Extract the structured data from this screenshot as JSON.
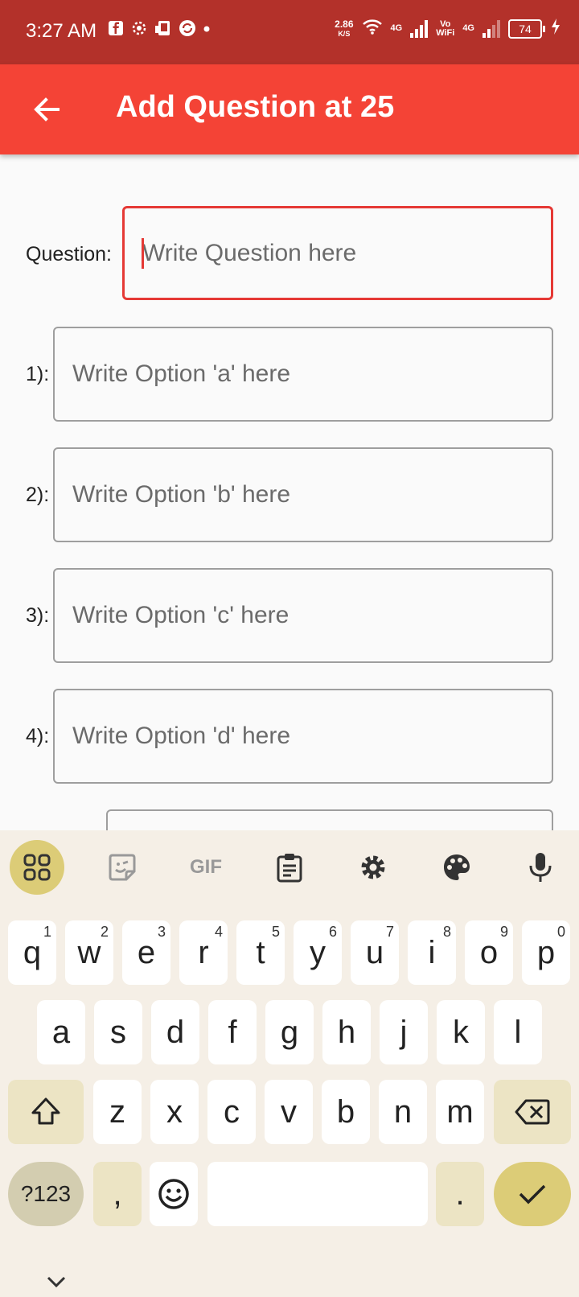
{
  "status_bar": {
    "time": "3:27 AM",
    "net_speed": "2.86",
    "net_unit": "K/S",
    "net_type_1": "4G",
    "vowifi_top": "Vo",
    "vowifi_bottom": "WiFi",
    "net_type_2": "4G",
    "battery": "74"
  },
  "app_bar": {
    "title": "Add Question at 25"
  },
  "form": {
    "question_label": "Question:",
    "question_placeholder": "Write Question here",
    "options": [
      {
        "label": "1):",
        "placeholder": "Write Option 'a' here"
      },
      {
        "label": "2):",
        "placeholder": "Write Option 'b' here"
      },
      {
        "label": "3):",
        "placeholder": "Write Option 'c' here"
      },
      {
        "label": "4):",
        "placeholder": "Write Option 'd' here"
      }
    ]
  },
  "keyboard": {
    "toolbar": {
      "gif_label": "GIF"
    },
    "row1": [
      {
        "key": "q",
        "hint": "1"
      },
      {
        "key": "w",
        "hint": "2"
      },
      {
        "key": "e",
        "hint": "3"
      },
      {
        "key": "r",
        "hint": "4"
      },
      {
        "key": "t",
        "hint": "5"
      },
      {
        "key": "y",
        "hint": "6"
      },
      {
        "key": "u",
        "hint": "7"
      },
      {
        "key": "i",
        "hint": "8"
      },
      {
        "key": "o",
        "hint": "9"
      },
      {
        "key": "p",
        "hint": "0"
      }
    ],
    "row2": [
      "a",
      "s",
      "d",
      "f",
      "g",
      "h",
      "j",
      "k",
      "l"
    ],
    "row3": [
      "z",
      "x",
      "c",
      "v",
      "b",
      "n",
      "m"
    ],
    "symbols_label": "?123",
    "comma": ",",
    "period": "."
  },
  "colors": {
    "status_bar": "#b3312a",
    "app_bar": "#f44336",
    "focus_border": "#e53935",
    "keyboard_bg": "#f5efe6",
    "enter_key": "#dccc77"
  }
}
